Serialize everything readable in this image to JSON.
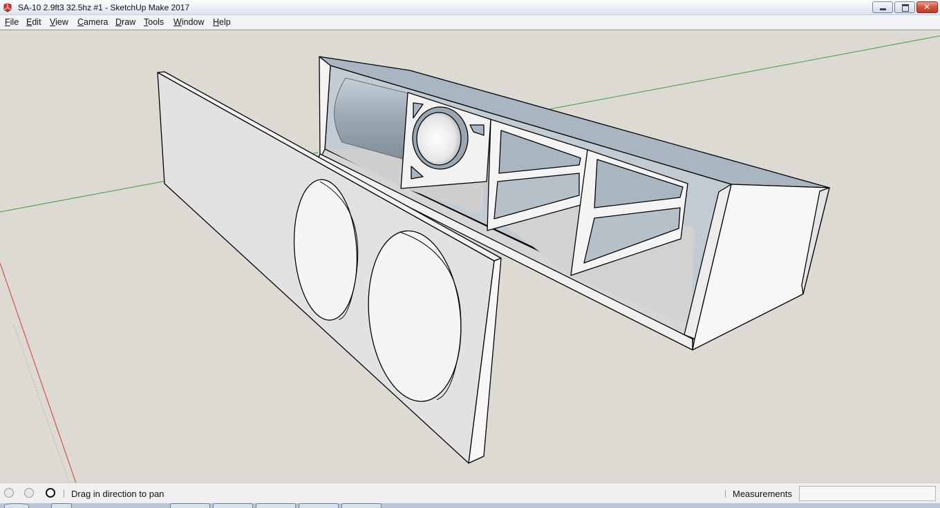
{
  "window": {
    "title": "SA-10 2.9ft3 32.5hz #1 - SketchUp Make 2017",
    "icon": "sketchup-logo-icon",
    "controls": [
      "minimize-icon",
      "maximize-icon",
      "close-icon"
    ]
  },
  "menu": {
    "items": [
      {
        "label": "File"
      },
      {
        "label": "Edit"
      },
      {
        "label": "View"
      },
      {
        "label": "Camera"
      },
      {
        "label": "Draw"
      },
      {
        "label": "Tools"
      },
      {
        "label": "Window"
      },
      {
        "label": "Help"
      }
    ]
  },
  "viewport": {
    "scene": "3D model of a speaker enclosure with detached front baffle",
    "colors": {
      "background": "#dcdad2",
      "face_light": "#f4f4f4",
      "face_mid": "#e2e2e2",
      "face_back": "#c2c8cf",
      "blue_gray": "#a9b6c1",
      "axis_green": "#3e9e3e",
      "axis_red": "#d23a2a"
    }
  },
  "status": {
    "icons": [
      "geolocation-icon",
      "credits-icon",
      "user-account-icon"
    ],
    "message": "Drag in direction to pan",
    "measurements_label": "Measurements",
    "measurements_value": ""
  }
}
